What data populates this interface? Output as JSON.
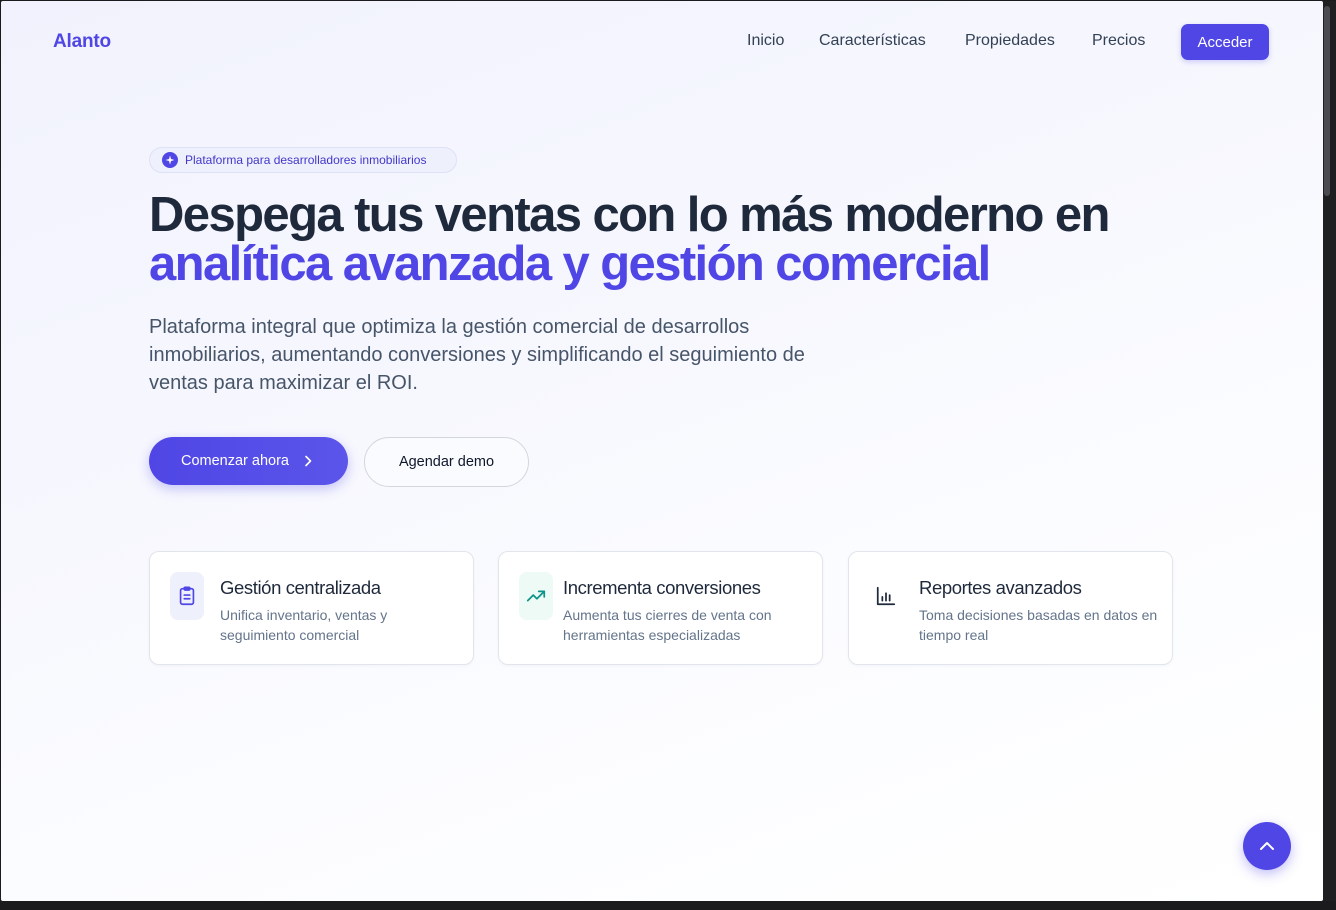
{
  "brand": "Alanto",
  "nav": {
    "links": [
      "Inicio",
      "Características",
      "Propiedades",
      "Precios"
    ],
    "login": "Acceder"
  },
  "hero": {
    "badge": "Plataforma para desarrolladores inmobiliarios",
    "title_line1": "Despega tus ventas con lo más moderno en",
    "title_line2": "analítica avanzada y gestión comercial",
    "subtitle": "Plataforma integral que optimiza la gestión comercial de desarrollos inmobiliarios, aumentando conversiones y simplificando el seguimiento de ventas para maximizar el ROI.",
    "cta_primary": "Comenzar ahora",
    "cta_secondary": "Agendar demo"
  },
  "features": [
    {
      "icon": "clipboard-icon",
      "title": "Gestión centralizada",
      "desc": "Unifica inventario, ventas y seguimiento comercial"
    },
    {
      "icon": "trending-up-icon",
      "title": "Incrementa conversiones",
      "desc": "Aumenta tus cierres de venta con herramientas especializadas"
    },
    {
      "icon": "bar-chart-icon",
      "title": "Reportes avanzados",
      "desc": "Toma decisiones basadas en datos en tiempo real"
    }
  ],
  "colors": {
    "accent": "#4f46e5",
    "heading": "#1e293b",
    "body_text": "#475569"
  }
}
